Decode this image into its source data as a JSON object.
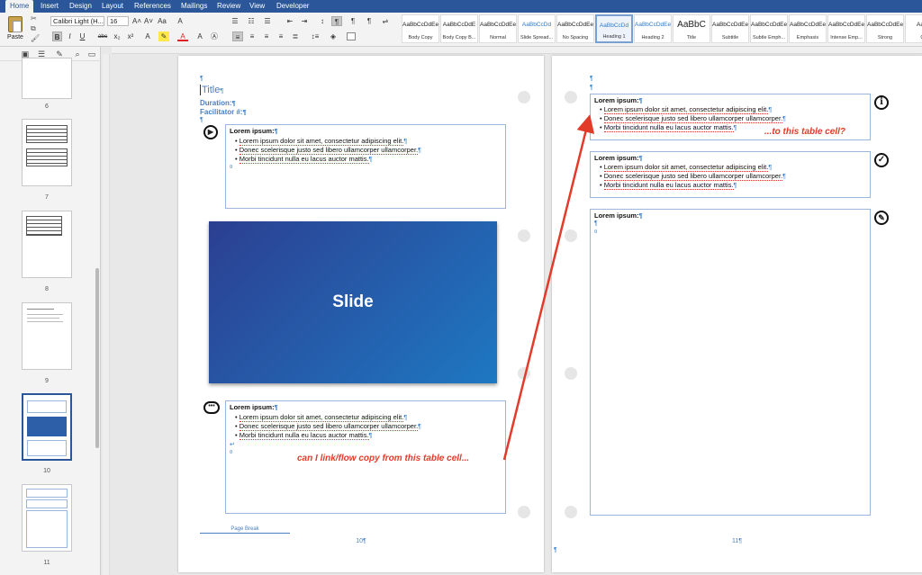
{
  "ribbon": {
    "tabs": [
      "Home",
      "Insert",
      "Design",
      "Layout",
      "References",
      "Mailings",
      "Review",
      "View",
      "Developer"
    ],
    "active_tab": "Home",
    "paste_label": "Paste",
    "font_name": "Calibri Light (H...",
    "font_size": "16",
    "styles": [
      {
        "preview": "AaBbCcDdEe",
        "name": "Body Copy"
      },
      {
        "preview": "AaBbCcDdE",
        "name": "Body Copy B..."
      },
      {
        "preview": "AaBbCcDdEe",
        "name": "Normal"
      },
      {
        "preview": "AaBbCcDd",
        "name": "Slide Spread..."
      },
      {
        "preview": "AaBbCcDdEe",
        "name": "No Spacing"
      },
      {
        "preview": "AaBbCcDd",
        "name": "Heading 1"
      },
      {
        "preview": "AaBbCcDdEe",
        "name": "Heading 2"
      },
      {
        "preview": "AaBbC",
        "name": "Title"
      },
      {
        "preview": "AaBbCcDdEe",
        "name": "Subtitle"
      },
      {
        "preview": "AaBbCcDdEe",
        "name": "Subtle Emph..."
      },
      {
        "preview": "AaBbCcDdEe",
        "name": "Emphasis"
      },
      {
        "preview": "AaBbCcDdEe",
        "name": "Intense Emp..."
      },
      {
        "preview": "AaBbCcDdEe",
        "name": "Strong"
      },
      {
        "preview": "AaBb",
        "name": "Qu"
      }
    ],
    "selected_style": "Heading 1"
  },
  "nav": {
    "thumb_numbers": [
      "6",
      "7",
      "8",
      "9",
      "10",
      "11"
    ],
    "selected": "10"
  },
  "page10": {
    "title": "Title",
    "duration": "Duration:",
    "facilitator": "Facilitator #:",
    "cell_title": "Lorem ipsum:",
    "bullets": [
      "Lorem ipsum dolor sit amet, consectetur adipiscing elit.",
      "Donec scelerisque justo sed libero ullamcorper ullamcorper.",
      "Morbi tincidunt nulla eu lacus auctor mattis."
    ],
    "slide_label": "Slide",
    "page_break": "Page Break",
    "page_number": "10",
    "annotation": "can I link/flow copy from this table cell..."
  },
  "page11": {
    "cell_title": "Lorem ipsum:",
    "bullets": [
      "Lorem ipsum dolor sit amet, consectetur adipiscing elit.",
      "Donec scelerisque justo sed libero ullamcorper ullamcorper.",
      "Morbi tincidunt nulla eu lacus auctor mattis."
    ],
    "page_number": "11",
    "annotation": "...to this table cell?"
  },
  "colors": {
    "accent": "#2b579a",
    "slide_from": "#2c3f91",
    "slide_to": "#1e78c2",
    "annotation": "#e23b2a"
  },
  "icons": [
    "play-icon",
    "speech-bubble-icon",
    "info-icon",
    "checkmark-icon",
    "notes-icon"
  ]
}
